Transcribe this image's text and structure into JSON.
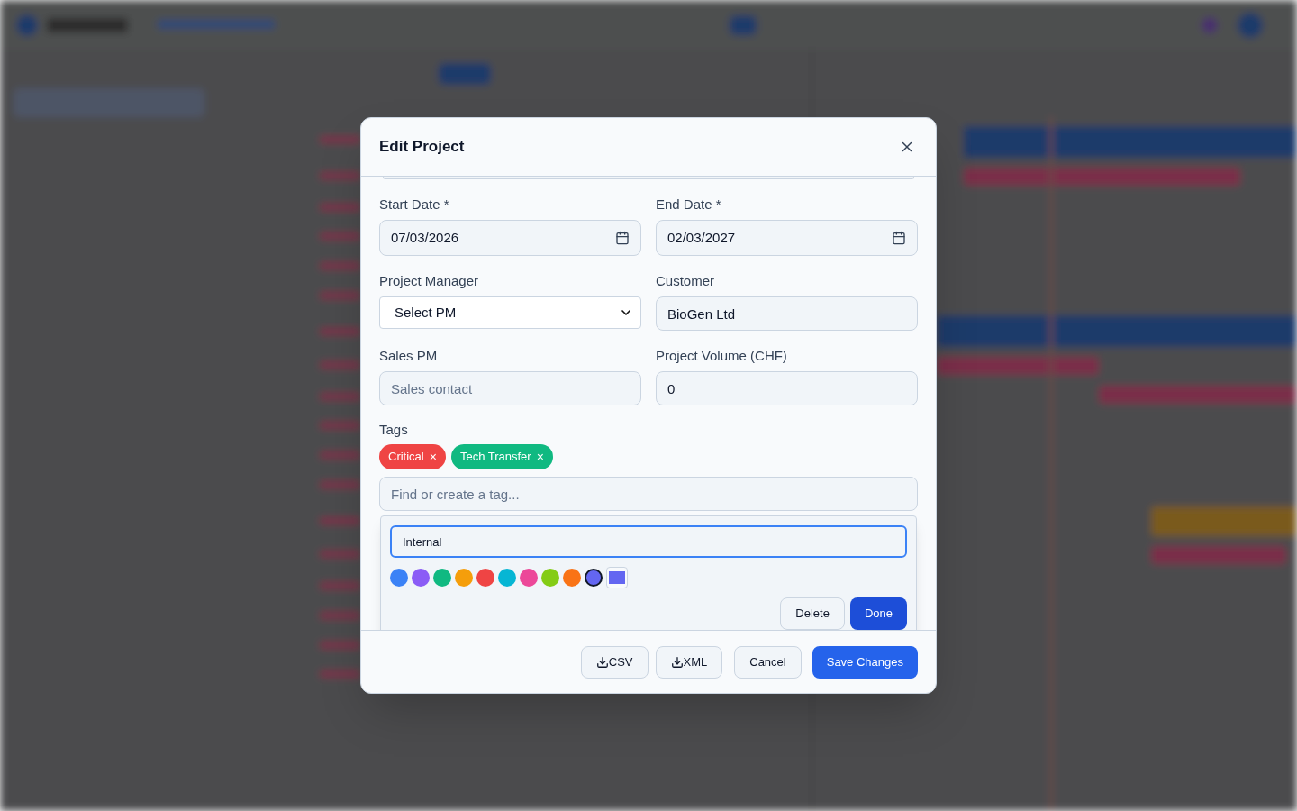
{
  "dialog": {
    "title": "Edit Project",
    "fields": [
      {
        "label": "Start Date *",
        "kind": "date",
        "value": "07/03/2026"
      },
      {
        "label": "End Date *",
        "kind": "date",
        "value": "02/03/2027"
      },
      {
        "label": "Project Manager",
        "kind": "select",
        "value": "Select PM"
      },
      {
        "label": "Customer",
        "kind": "text",
        "value": "BioGen Ltd"
      },
      {
        "label": "Sales PM",
        "kind": "text",
        "placeholder": "Sales contact"
      },
      {
        "label": "Project Volume (CHF)",
        "kind": "text",
        "value": "0"
      }
    ],
    "tags": {
      "label": "Tags",
      "items": [
        {
          "label": "Critical",
          "remove": "×",
          "color": "#ef4444"
        },
        {
          "label": "Tech Transfer",
          "remove": "×",
          "color": "#10b981"
        }
      ],
      "search": {
        "placeholder": "Find or create a tag..."
      },
      "editor": {
        "name": "Internal",
        "swatches": [
          {
            "color": "#3b82f6",
            "selected": false
          },
          {
            "color": "#8b5cf6",
            "selected": false
          },
          {
            "color": "#10b981",
            "selected": false
          },
          {
            "color": "#f59e0b",
            "selected": false
          },
          {
            "color": "#ef4444",
            "selected": false
          },
          {
            "color": "#06b6d4",
            "selected": false
          },
          {
            "color": "#ec4899",
            "selected": false
          },
          {
            "color": "#84cc16",
            "selected": false
          },
          {
            "color": "#f97316",
            "selected": false
          },
          {
            "color": "#6366f1",
            "selected": true
          }
        ],
        "buttons": [
          {
            "label": "Delete",
            "kind": "secondary"
          },
          {
            "label": "Done",
            "kind": "primary"
          }
        ]
      }
    },
    "footer": [
      {
        "label": "CSV",
        "kind": "export"
      },
      {
        "label": "XML",
        "kind": "export"
      },
      {
        "label": "Cancel",
        "kind": "secondary"
      },
      {
        "label": "Save Changes",
        "kind": "primary"
      }
    ]
  }
}
